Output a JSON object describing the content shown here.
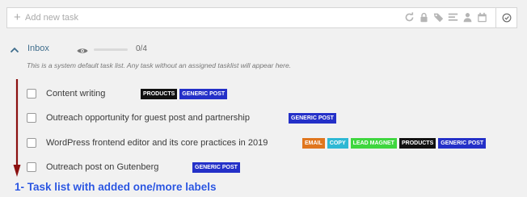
{
  "add_task": {
    "placeholder": "Add new task"
  },
  "toolbar": {
    "icons": [
      "refresh-icon",
      "lock-icon",
      "tag-icon",
      "priority-icon",
      "assign-icon",
      "calendar-icon",
      "check-circle-icon"
    ]
  },
  "tasklist": {
    "title": "Inbox",
    "progress_fraction": 0,
    "count": "0/4",
    "description": "This is a system default task list. Any task without an assigned tasklist will appear here."
  },
  "tasks": [
    {
      "text": "Content writing",
      "labels": [
        {
          "text": "PRODUCTS",
          "color": "#111111"
        },
        {
          "text": "GENERIC POST",
          "color": "#2430c8"
        }
      ]
    },
    {
      "text": "Outreach opportunity for guest post and partnership",
      "labels": [
        {
          "text": "GENERIC POST",
          "color": "#2430c8"
        }
      ]
    },
    {
      "text": "WordPress frontend editor and its core practices in 2019",
      "labels": [
        {
          "text": "EMAIL",
          "color": "#e0761e"
        },
        {
          "text": "COPY",
          "color": "#2eb8d4"
        },
        {
          "text": "LEAD MAGNET",
          "color": "#3fd63f"
        },
        {
          "text": "PRODUCTS",
          "color": "#111111"
        },
        {
          "text": "GENERIC POST",
          "color": "#2430c8"
        }
      ]
    },
    {
      "text": "Outreach post on Gutenberg",
      "labels": [
        {
          "text": "GENERIC POST",
          "color": "#2430c8"
        }
      ]
    }
  ],
  "annotation": {
    "text": "1- Task list with added one/more labels",
    "color": "#2a55e0"
  },
  "colors": {
    "arrow": "#8b1010",
    "title": "#3f6d8c"
  }
}
